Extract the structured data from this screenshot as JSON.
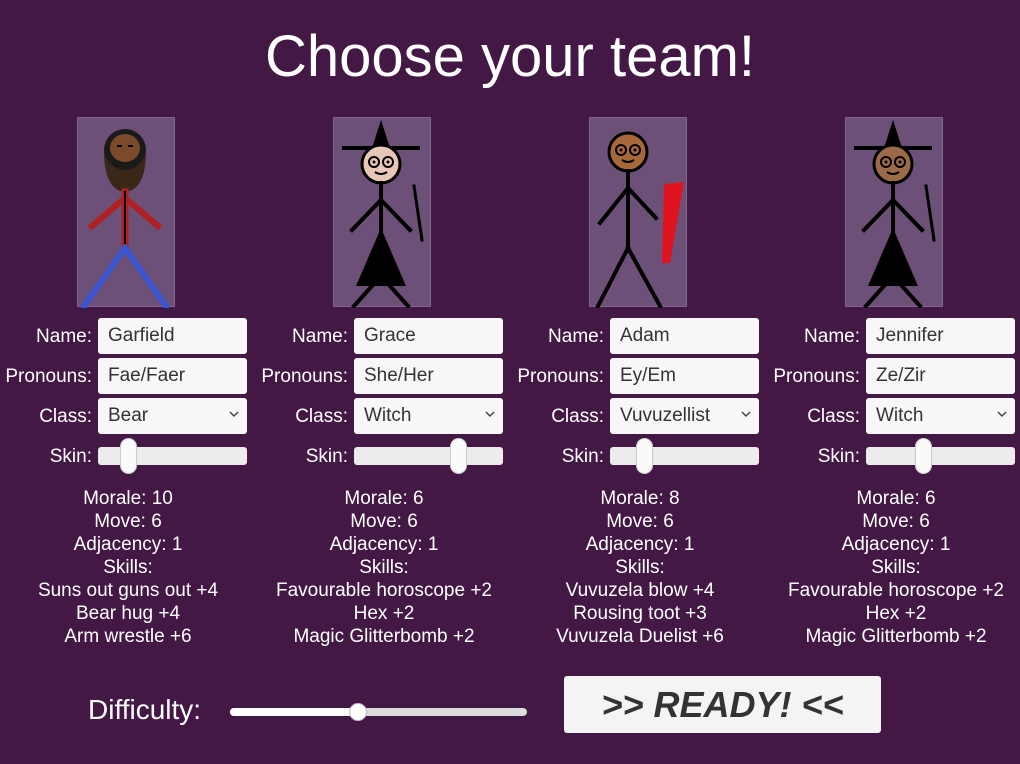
{
  "title": "Choose your team!",
  "labels": {
    "name": "Name:",
    "pronouns": "Pronouns:",
    "class": "Class:",
    "skin": "Skin:",
    "skills": "Skills:"
  },
  "characters": [
    {
      "name": "Garfield",
      "pronouns": "Fae/Faer",
      "class": "Bear",
      "skin_level": 0.2,
      "morale": "Morale: 10",
      "move": "Move: 6",
      "adjacency": "Adjacency: 1",
      "skills": [
        "Suns out guns out +4",
        "Bear hug +4",
        "Arm wrestle +6"
      ],
      "sprite": "bear-sprite",
      "skin_color": "#7a4a2a"
    },
    {
      "name": "Grace",
      "pronouns": "She/Her",
      "class": "Witch",
      "skin_level": 0.7,
      "morale": "Morale: 6",
      "move": "Move: 6",
      "adjacency": "Adjacency: 1",
      "skills": [
        "Favourable horoscope +2",
        "Hex +2",
        "Magic Glitterbomb +2"
      ],
      "sprite": "witch-sprite",
      "skin_color": "#e8c7b8"
    },
    {
      "name": "Adam",
      "pronouns": "Ey/Em",
      "class": "Vuvuzellist",
      "skin_level": 0.23,
      "morale": "Morale: 8",
      "move": "Move: 6",
      "adjacency": "Adjacency: 1",
      "skills": [
        "Vuvuzela blow +4",
        "Rousing toot +3",
        "Vuvuzela Duelist +6"
      ],
      "sprite": "vuvuzellist-sprite",
      "skin_color": "#a8693a"
    },
    {
      "name": "Jennifer",
      "pronouns": "Ze/Zir",
      "class": "Witch",
      "skin_level": 0.38,
      "morale": "Morale: 6",
      "move": "Move: 6",
      "adjacency": "Adjacency: 1",
      "skills": [
        "Favourable horoscope +2",
        "Hex +2",
        "Magic Glitterbomb +2"
      ],
      "sprite": "witch-sprite",
      "skin_color": "#9b6a48"
    }
  ],
  "difficulty": {
    "label": "Difficulty:",
    "level": 0.43
  },
  "ready_label": ">> READY! <<",
  "colors": {
    "background": "#431844",
    "portrait_bg": "#6c5077"
  }
}
